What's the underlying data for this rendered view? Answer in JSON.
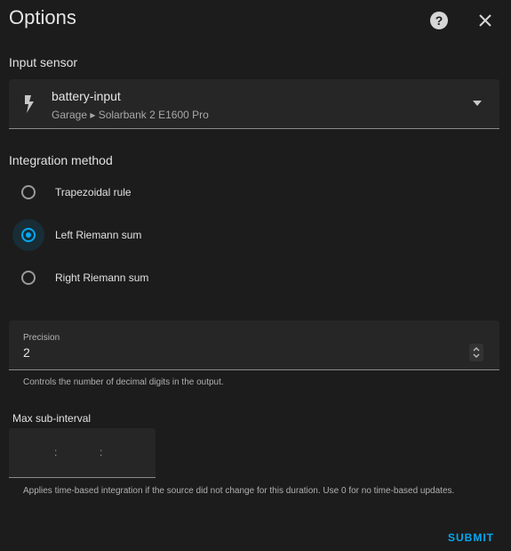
{
  "dialog": {
    "title": "Options",
    "help_icon": "help-circle-icon",
    "close_icon": "close-icon"
  },
  "input_sensor": {
    "label": "Input sensor",
    "value": "battery-input",
    "context": "Garage ▸ Solarbank 2 E1600 Pro",
    "icon": "lightning-bolt-icon"
  },
  "integration_method": {
    "label": "Integration method",
    "options": [
      {
        "label": "Trapezoidal rule",
        "checked": false
      },
      {
        "label": "Left Riemann sum",
        "checked": true
      },
      {
        "label": "Right Riemann sum",
        "checked": false
      }
    ]
  },
  "precision": {
    "label": "Precision",
    "value": "2",
    "helper": "Controls the number of decimal digits in the output."
  },
  "max_sub_interval": {
    "label": "Max sub-interval",
    "separator": ":",
    "helper": "Applies time-based integration if the source did not change for this duration. Use 0 for no time-based updates."
  },
  "actions": {
    "submit_label": "SUBMIT"
  },
  "colors": {
    "accent": "#03a9f4",
    "background": "#1c1c1c",
    "field_background": "#262626"
  }
}
